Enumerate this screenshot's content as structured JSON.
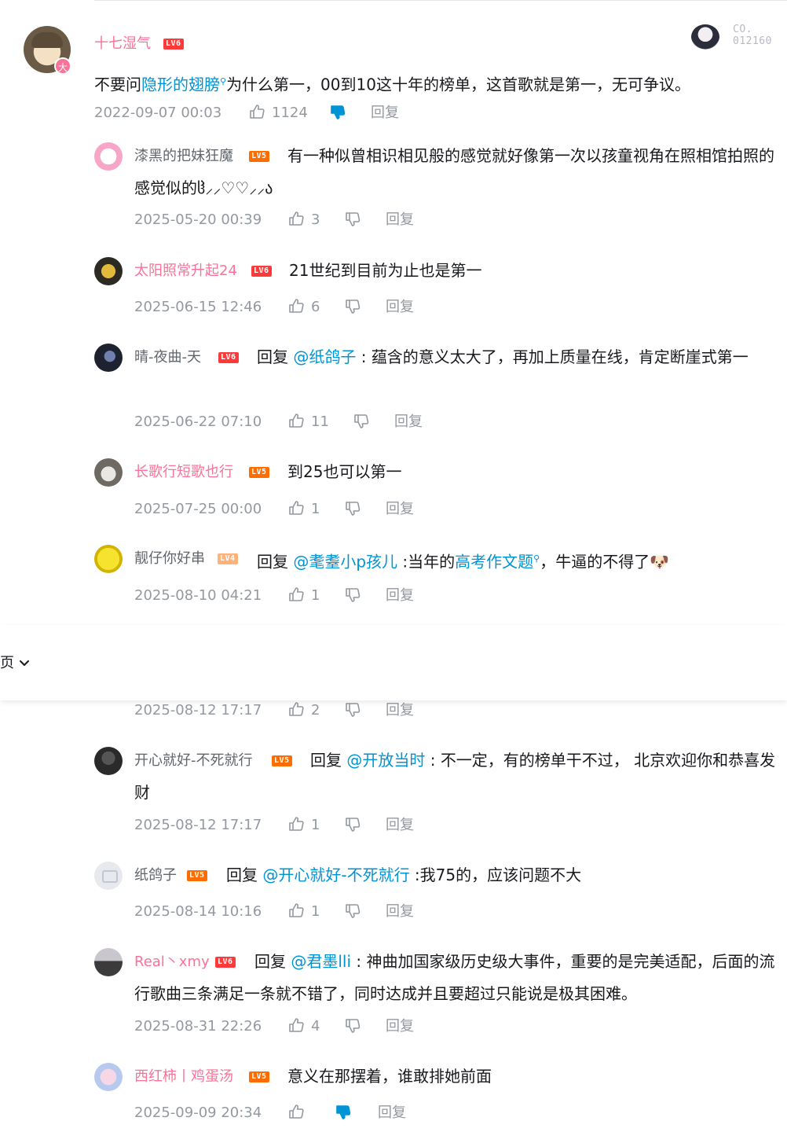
{
  "main_comment": {
    "username": "十七湿气",
    "level": "LV6",
    "badge": "大",
    "deco_text_line1": "CO.",
    "deco_text_line2": "012160",
    "text_before": "不要问",
    "link_text": "隐形的翅膀",
    "text_after": "为什么第一，00到10这十年的榜单，这首歌就是第一，无可争议。",
    "date": "2022-09-07 00:03",
    "likes": "1124",
    "reply_label": "回复"
  },
  "replies": [
    {
      "username": "漆黑的把妹狂魔",
      "level": "LV5",
      "text": "有一种似曾相识相见般的感觉就好像第一次以孩童视角在照相馆拍照的感觉似的ჱ̒⸝⸝♡♡⸝⸝ა",
      "date": "2025-05-20 00:39",
      "likes": "3",
      "reply_label": "回复"
    },
    {
      "username": "太阳照常升起24",
      "level": "LV6",
      "text": "21世纪到目前为止也是第一",
      "date": "2025-06-15 12:46",
      "likes": "6",
      "reply_label": "回复"
    },
    {
      "username": "晴-夜曲-天",
      "level": "LV6",
      "prefix": "回复",
      "mention": "@纸鸽子",
      "text": " : 蕴含的意义太大了，再加上质量在线，肯定断崖式第一",
      "date": "2025-06-22 07:10",
      "likes": "11",
      "reply_label": "回复"
    },
    {
      "username": "长歌行短歌也行",
      "level": "LV5",
      "text": "到25也可以第一",
      "date": "2025-07-25 00:00",
      "likes": "1",
      "reply_label": "回复"
    },
    {
      "username": "靓仔你好串",
      "level": "LV4",
      "prefix": "回复",
      "mention": "@耄耋小p孩儿",
      "text_before_link": " :当年的",
      "link": "高考作文题",
      "text_after_link": "，牛逼的不得了🐶",
      "date": "2025-08-10 04:21",
      "likes": "1",
      "reply_label": "回复"
    },
    {
      "date": "2025-08-12 17:17",
      "likes": "2",
      "reply_label": "回复"
    },
    {
      "username": "开心就好-不死就行",
      "level": "LV5",
      "prefix": "回复",
      "mention": "@开放当时",
      "text": " : 不一定，有的榜单干不过， 北京欢迎你和恭喜发财",
      "date": "2025-08-12 17:17",
      "likes": "1",
      "reply_label": "回复"
    },
    {
      "username": "纸鸽子",
      "level": "LV5",
      "prefix": "回复",
      "mention": "@开心就好-不死就行",
      "text": " :我75的，应该问题不大",
      "date": "2025-08-14 10:16",
      "likes": "1",
      "reply_label": "回复"
    },
    {
      "username": "Real丶xmy",
      "level": "LV6",
      "prefix": "回复",
      "mention": "@君墨lli",
      "text": " : 神曲加国家级历史级大事件，重要的是完美适配，后面的流行歌曲三条满足一条就不错了，同时达成并且要超过只能说是极其困难。",
      "date": "2025-08-31 22:26",
      "likes": "4",
      "reply_label": "回复"
    },
    {
      "username": "西红柿丨鸡蛋汤",
      "level": "LV5",
      "text": "意义在那摆着，谁敢排她前面",
      "date": "2025-09-09 20:34",
      "likes": "",
      "reply_label": "回复"
    }
  ],
  "overlay": {
    "label": "页"
  },
  "colors": {
    "accent_blue": "#0093d6",
    "pink": "#fb7299",
    "meta_gray": "#9499a0"
  }
}
